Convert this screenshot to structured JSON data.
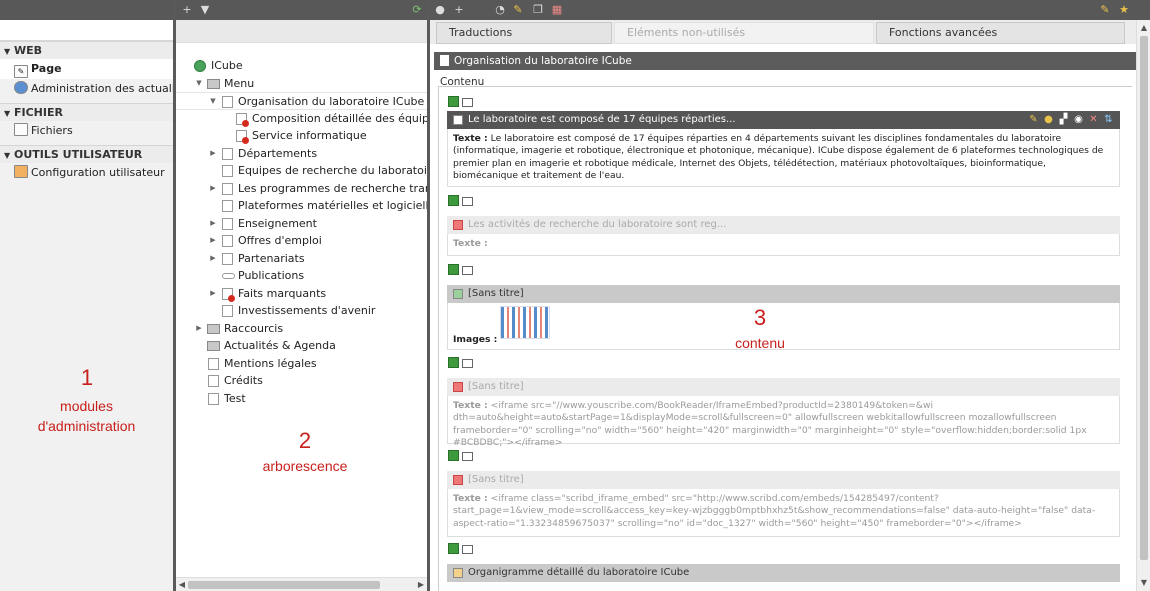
{
  "toolbar": {
    "icons": [
      "new-page-icon",
      "filter-icon",
      "refresh-icon",
      "view-icon",
      "new-content-icon",
      "history-icon",
      "edit-icon",
      "copy-icon",
      "delete-icon",
      "bookmark-icon",
      "star-icon"
    ]
  },
  "modules": {
    "sections": [
      {
        "title": "WEB",
        "items": [
          "Page",
          "Administration des actualités"
        ]
      },
      {
        "title": "FICHIER",
        "items": [
          "Fichiers"
        ]
      },
      {
        "title": "OUTILS UTILISATEUR",
        "items": [
          "Configuration utilisateur"
        ]
      }
    ],
    "annotation_number": "1",
    "annotation_line1": "modules",
    "annotation_line2": "d'administration"
  },
  "tree": {
    "nodes": [
      "ICube",
      "Menu",
      "Organisation du laboratoire ICube",
      "Composition détaillée des équipes",
      "Service informatique",
      "Départements",
      "Equipes de recherche du laboratoire I",
      "Les programmes de recherche transve",
      "Plateformes matérielles et logicielles",
      "Enseignement",
      "Offres d'emploi",
      "Partenariats",
      "Publications",
      "Faits marquants",
      "Investissements d'avenir",
      "Raccourcis",
      "Actualités & Agenda",
      "Mentions légales",
      "Crédits",
      "Test"
    ],
    "annotation_number": "2",
    "annotation_label": "arborescence"
  },
  "content": {
    "tabs": [
      "Traductions",
      "Eléments non-utilisés",
      "Fonctions avancées"
    ],
    "page_title": "Organisation du laboratoire ICube",
    "section_label": "Contenu",
    "elements": [
      {
        "header": "Le laboratoire est composé de 17 équipes réparties...",
        "label": "Texte :",
        "body": "Le laboratoire est composé de 17 équipes réparties en 4 départements suivant les disciplines fondamentales du laboratoire (informatique, imagerie et robotique, électronique et photonique, mécanique). ICube dispose également de 6 plateformes technologiques de premier plan en imagerie et robotique médicale, Internet des Objets, télédétection, matériaux photovoltaïques, bioinformatique, biomécanique et traitement de l'eau."
      },
      {
        "header": "Les activités de recherche du laboratoire sont reg...",
        "label": "Texte :",
        "body": ""
      },
      {
        "header": "[Sans titre]",
        "label": "Images :",
        "body": ""
      },
      {
        "header": "[Sans titre]",
        "label": "Texte :",
        "body": "<iframe src=\"//www.youscribe.com/BookReader/IframeEmbed?productId=2380149&token=&wi dth=auto&height=auto&startPage=1&displayMode=scroll&fullscreen=0\" allowfullscreen webkitallowfullscreen mozallowfullscreen frameborder=\"0\" scrolling=\"no\" width=\"560\" height=\"420\" marginwidth=\"0\" marginheight=\"0\" style=\"overflow:hidden;border:solid 1px #BCBDBC;\"></iframe>"
      },
      {
        "header": "[Sans titre]",
        "label": "Texte :",
        "body": "<iframe class=\"scribd_iframe_embed\" src=\"http://www.scribd.com/embeds/154285497/content?start_page=1&view_mode=scroll&access_key=key-wjzbgggb0mptbhxhz5t&show_recommendations=false\" data-auto-height=\"false\" data-aspect-ratio=\"1.33234859675037\" scrolling=\"no\" id=\"doc_1327\" width=\"560\" height=\"450\" frameborder=\"0\"></iframe>"
      },
      {
        "header": "Organigramme détaillé du laboratoire ICube",
        "label": "",
        "body": ""
      }
    ],
    "annotation_number": "3",
    "annotation_label": "contenu"
  }
}
